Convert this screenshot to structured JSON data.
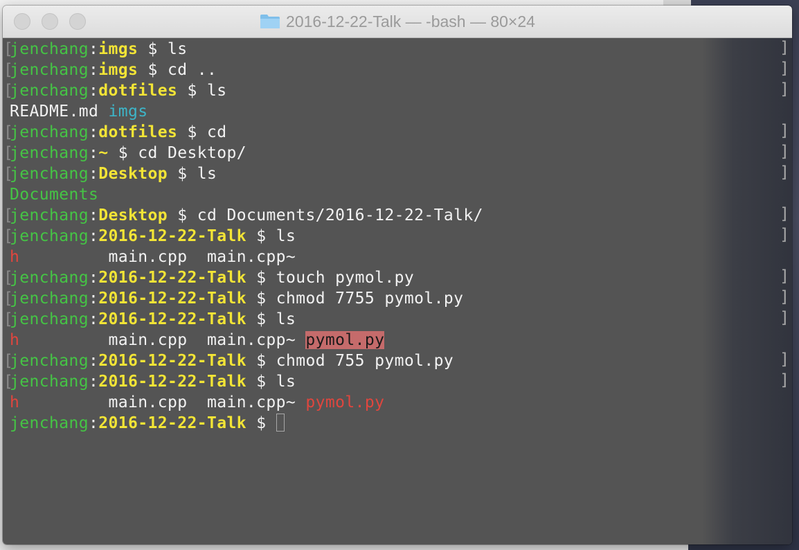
{
  "window": {
    "title": "2016-12-22-Talk — -bash — 80×24"
  },
  "icons": {
    "folder": "folder-icon",
    "close": "close-button",
    "minimize": "minimize-button",
    "zoom": "zoom-button"
  },
  "colors": {
    "terminal_bg": "#545454",
    "user": "#45c445",
    "directory": "#f2e436",
    "ls_dir": "#3db6c9",
    "executable": "#e0463e",
    "setuid_highlight": "#c56b6b"
  },
  "terminal": {
    "prompt_user": "jenchang",
    "lines": [
      {
        "type": "prompt",
        "bracket": true,
        "dir": "imgs",
        "cmd": "ls"
      },
      {
        "type": "prompt",
        "bracket": true,
        "dir": "imgs",
        "cmd": "cd .."
      },
      {
        "type": "prompt",
        "bracket": true,
        "dir": "dotfiles",
        "cmd": "ls"
      },
      {
        "type": "output",
        "items": [
          {
            "text": "README.md",
            "style": "plain"
          },
          {
            "text": "imgs",
            "style": "dir"
          }
        ]
      },
      {
        "type": "prompt",
        "bracket": true,
        "dir": "dotfiles",
        "cmd": "cd"
      },
      {
        "type": "prompt",
        "bracket": true,
        "dir": "~",
        "cmd": "cd Desktop/"
      },
      {
        "type": "prompt",
        "bracket": true,
        "dir": "Desktop",
        "cmd": "ls"
      },
      {
        "type": "output",
        "items": [
          {
            "text": "Documents",
            "style": "green"
          }
        ]
      },
      {
        "type": "prompt",
        "bracket": true,
        "dir": "Desktop",
        "cmd": "cd Documents/2016-12-22-Talk/"
      },
      {
        "type": "prompt",
        "bracket": true,
        "dir": "2016-12-22-Talk",
        "cmd": "ls"
      },
      {
        "type": "output",
        "items": [
          {
            "text": "h",
            "style": "red"
          },
          {
            "text": "         main.cpp  main.cpp~",
            "style": "plain"
          }
        ]
      },
      {
        "type": "prompt",
        "bracket": true,
        "dir": "2016-12-22-Talk",
        "cmd": "touch pymol.py"
      },
      {
        "type": "prompt",
        "bracket": true,
        "dir": "2016-12-22-Talk",
        "cmd": "chmod 7755 pymol.py"
      },
      {
        "type": "prompt",
        "bracket": true,
        "dir": "2016-12-22-Talk",
        "cmd": "ls"
      },
      {
        "type": "output",
        "items": [
          {
            "text": "h",
            "style": "red"
          },
          {
            "text": "         main.cpp  main.cpp~ ",
            "style": "plain"
          },
          {
            "text": "pymol.py",
            "style": "highlight"
          }
        ]
      },
      {
        "type": "prompt",
        "bracket": true,
        "dir": "2016-12-22-Talk",
        "cmd": "chmod 755 pymol.py"
      },
      {
        "type": "prompt",
        "bracket": true,
        "dir": "2016-12-22-Talk",
        "cmd": "ls"
      },
      {
        "type": "output",
        "items": [
          {
            "text": "h",
            "style": "red"
          },
          {
            "text": "         main.cpp  main.cpp~ ",
            "style": "plain"
          },
          {
            "text": "pymol.py",
            "style": "red"
          }
        ]
      },
      {
        "type": "prompt",
        "bracket": false,
        "dir": "2016-12-22-Talk",
        "cmd": "",
        "cursor": true
      }
    ]
  }
}
